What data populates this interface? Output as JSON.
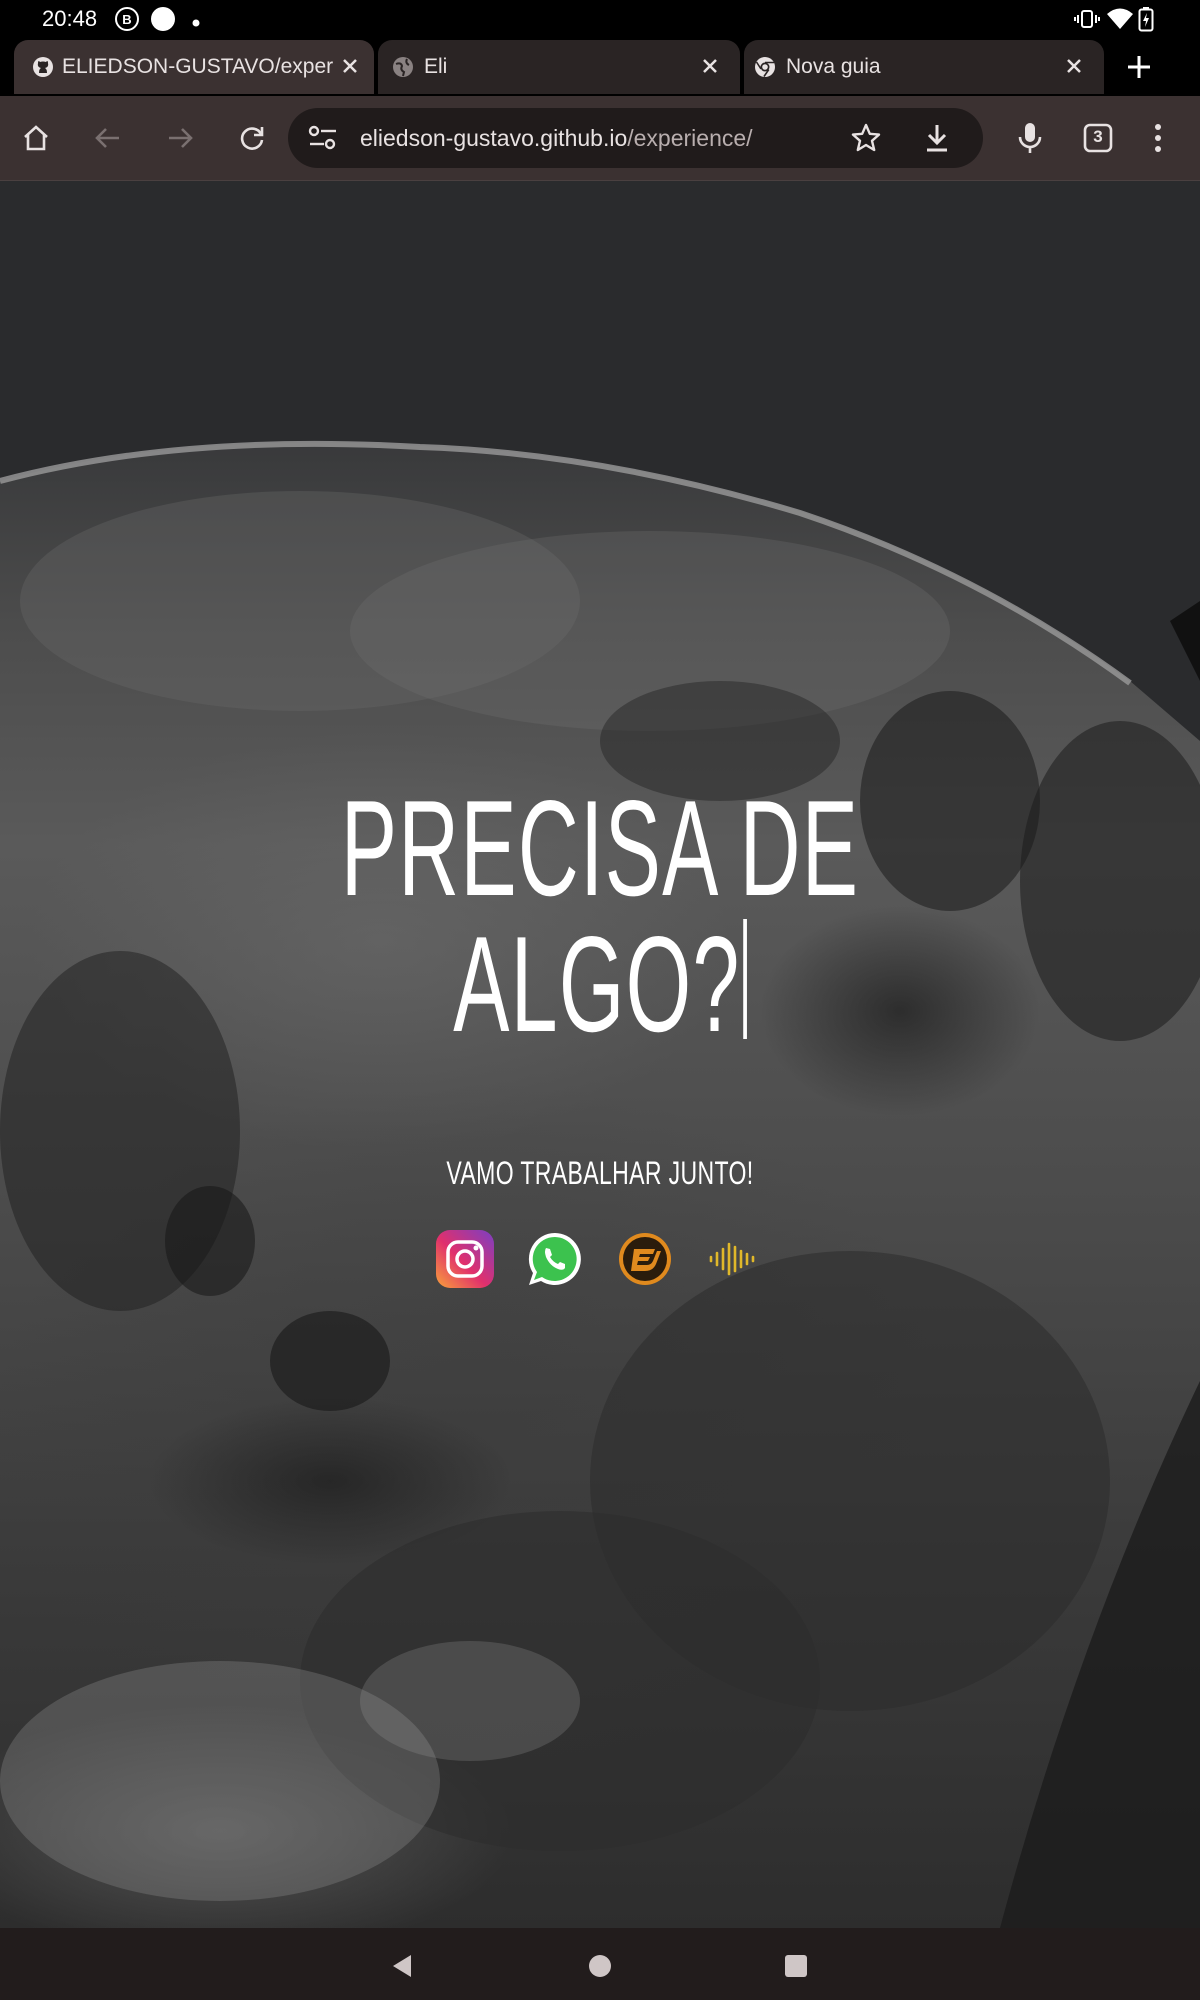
{
  "status_bar": {
    "time": "20:48",
    "left_icons": [
      "b-circle-icon",
      "circle-icon",
      "dot-icon"
    ],
    "right_icons": [
      "vibrate-icon",
      "wifi-icon",
      "battery-icon"
    ]
  },
  "tabs": [
    {
      "title": "ELIEDSON-GUSTAVO/experience",
      "favicon": "github-icon",
      "active": true
    },
    {
      "title": "Eli",
      "favicon": "globe-icon",
      "active": false
    },
    {
      "title": "Nova guia",
      "favicon": "chrome-icon",
      "active": false
    }
  ],
  "toolbar": {
    "url_host": "eliedson-gustavo.github.io",
    "url_path": "/experience/",
    "tab_count": "3"
  },
  "page": {
    "headline": "PRECISA DE ALGO?",
    "subhead": "VAMO TRABALHAR JUNTO!",
    "social": [
      {
        "name": "instagram-icon"
      },
      {
        "name": "whatsapp-icon"
      },
      {
        "name": "ej-logo-icon"
      },
      {
        "name": "audio-wave-icon"
      }
    ]
  },
  "colors": {
    "toolbar_bg": "#3b3131",
    "tab_strip_bg": "#000000",
    "omnibox_bg": "#201b1b",
    "navbar_bg": "#221c1c",
    "audio_icon": "#e0b82a"
  }
}
